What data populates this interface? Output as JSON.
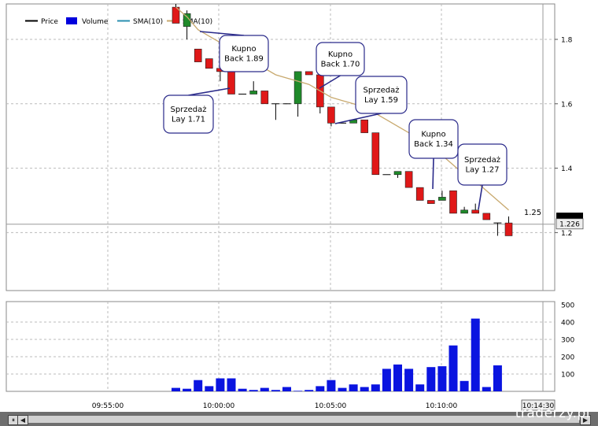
{
  "chart_data": [
    {
      "type": "candlestick",
      "title": "",
      "legend": [
        {
          "name": "Price",
          "color": "#000000"
        },
        {
          "name": "Volume",
          "color": "#0000dd"
        },
        {
          "name": "SMA(10)",
          "color": "#2a8fb0"
        },
        {
          "name": "SMA(10)",
          "color": "#c8a96e"
        }
      ],
      "legend_position": "top-left",
      "y_ticks": [
        1.2,
        1.4,
        1.6,
        1.8
      ],
      "ylim": [
        1.02,
        1.91
      ],
      "x_ticks": [
        "09:55:00",
        "10:00:00",
        "10:05:00",
        "10:10:00"
      ],
      "current_price_label": "1.25",
      "cursor_price_label": "1.226",
      "cursor_time_label": "10:14:30",
      "candles": [
        {
          "o": 1.9,
          "c": 1.85,
          "h": 1.91,
          "l": 1.85
        },
        {
          "o": 1.84,
          "c": 1.88,
          "h": 1.89,
          "l": 1.8
        },
        {
          "o": 1.77,
          "c": 1.73,
          "h": 1.77,
          "l": 1.73
        },
        {
          "o": 1.74,
          "c": 1.71,
          "h": 1.74,
          "l": 1.71
        },
        {
          "o": 1.71,
          "c": 1.7,
          "h": 1.71,
          "l": 1.67
        },
        {
          "o": 1.7,
          "c": 1.63,
          "h": 1.7,
          "l": 1.63
        },
        {
          "o": 1.63,
          "c": 1.63,
          "h": 1.63,
          "l": 1.63
        },
        {
          "o": 1.63,
          "c": 1.64,
          "h": 1.67,
          "l": 1.63
        },
        {
          "o": 1.64,
          "c": 1.6,
          "h": 1.64,
          "l": 1.6
        },
        {
          "o": 1.6,
          "c": 1.6,
          "h": 1.6,
          "l": 1.55
        },
        {
          "o": 1.6,
          "c": 1.6,
          "h": 1.6,
          "l": 1.6
        },
        {
          "o": 1.6,
          "c": 1.7,
          "h": 1.7,
          "l": 1.56
        },
        {
          "o": 1.7,
          "c": 1.69,
          "h": 1.7,
          "l": 1.69
        },
        {
          "o": 1.69,
          "c": 1.59,
          "h": 1.69,
          "l": 1.57
        },
        {
          "o": 1.59,
          "c": 1.54,
          "h": 1.59,
          "l": 1.53
        },
        {
          "o": 1.54,
          "c": 1.54,
          "h": 1.54,
          "l": 1.54
        },
        {
          "o": 1.54,
          "c": 1.55,
          "h": 1.55,
          "l": 1.54
        },
        {
          "o": 1.55,
          "c": 1.51,
          "h": 1.55,
          "l": 1.51
        },
        {
          "o": 1.51,
          "c": 1.38,
          "h": 1.51,
          "l": 1.38
        },
        {
          "o": 1.38,
          "c": 1.38,
          "h": 1.38,
          "l": 1.38
        },
        {
          "o": 1.38,
          "c": 1.39,
          "h": 1.39,
          "l": 1.37
        },
        {
          "o": 1.39,
          "c": 1.34,
          "h": 1.39,
          "l": 1.34
        },
        {
          "o": 1.34,
          "c": 1.3,
          "h": 1.34,
          "l": 1.3
        },
        {
          "o": 1.3,
          "c": 1.29,
          "h": 1.3,
          "l": 1.29
        },
        {
          "o": 1.3,
          "c": 1.31,
          "h": 1.33,
          "l": 1.3
        },
        {
          "o": 1.33,
          "c": 1.26,
          "h": 1.33,
          "l": 1.26
        },
        {
          "o": 1.26,
          "c": 1.27,
          "h": 1.28,
          "l": 1.26
        },
        {
          "o": 1.27,
          "c": 1.26,
          "h": 1.29,
          "l": 1.26
        },
        {
          "o": 1.26,
          "c": 1.24,
          "h": 1.26,
          "l": 1.24
        },
        {
          "o": 1.23,
          "c": 1.23,
          "h": 1.23,
          "l": 1.19
        },
        {
          "o": 1.23,
          "c": 1.19,
          "h": 1.25,
          "l": 1.19
        }
      ],
      "sma_fast": [
        1.9,
        1.87,
        1.83,
        1.81,
        1.79,
        1.77,
        1.75,
        1.74,
        1.71,
        1.69,
        1.68,
        1.67,
        1.66,
        1.64,
        1.62,
        1.61,
        1.6,
        1.59,
        1.57,
        1.55,
        1.53,
        1.51,
        1.48,
        1.46,
        1.44,
        1.41,
        1.38,
        1.36,
        1.33,
        1.3,
        1.27
      ],
      "sma_slow": [
        1.9,
        1.87,
        1.83,
        1.81,
        1.79,
        1.77,
        1.75,
        1.74,
        1.71,
        1.69,
        1.68,
        1.67,
        1.66,
        1.64,
        1.62,
        1.61,
        1.6,
        1.59,
        1.57,
        1.55,
        1.53,
        1.51,
        1.48,
        1.46,
        1.44,
        1.41,
        1.38,
        1.36,
        1.33,
        1.3,
        1.27
      ],
      "annotations": [
        {
          "text": [
            "Kupno",
            "Back 1.89"
          ],
          "candle": 1
        },
        {
          "text": [
            "Sprzedaż",
            "Lay 1.71"
          ],
          "candle": 4
        },
        {
          "text": [
            "Kupno",
            "Back 1.70"
          ],
          "candle": 12
        },
        {
          "text": [
            "Sprzedaż",
            "Lay 1.59"
          ],
          "candle": 13
        },
        {
          "text": [
            "Kupno",
            "Back 1.34"
          ],
          "candle": 22
        },
        {
          "text": [
            "Sprzedaż",
            "Lay 1.27"
          ],
          "candle": 26
        }
      ]
    },
    {
      "type": "bar",
      "series": [
        {
          "name": "Volume",
          "values": [
            20,
            15,
            65,
            30,
            75,
            75,
            15,
            8,
            20,
            8,
            25,
            3,
            8,
            30,
            65,
            20,
            40,
            25,
            40,
            130,
            155,
            130,
            40,
            140,
            145,
            265,
            60,
            420,
            25,
            150
          ]
        }
      ],
      "y_ticks": [
        100,
        200,
        300,
        400,
        500
      ],
      "ylim": [
        0,
        500
      ]
    }
  ],
  "branding": {
    "logo_text": "traderzy.pl"
  },
  "scrollbar": {
    "left_btn": "◀",
    "right_btn": "▶",
    "pause_btn": "⏸"
  }
}
